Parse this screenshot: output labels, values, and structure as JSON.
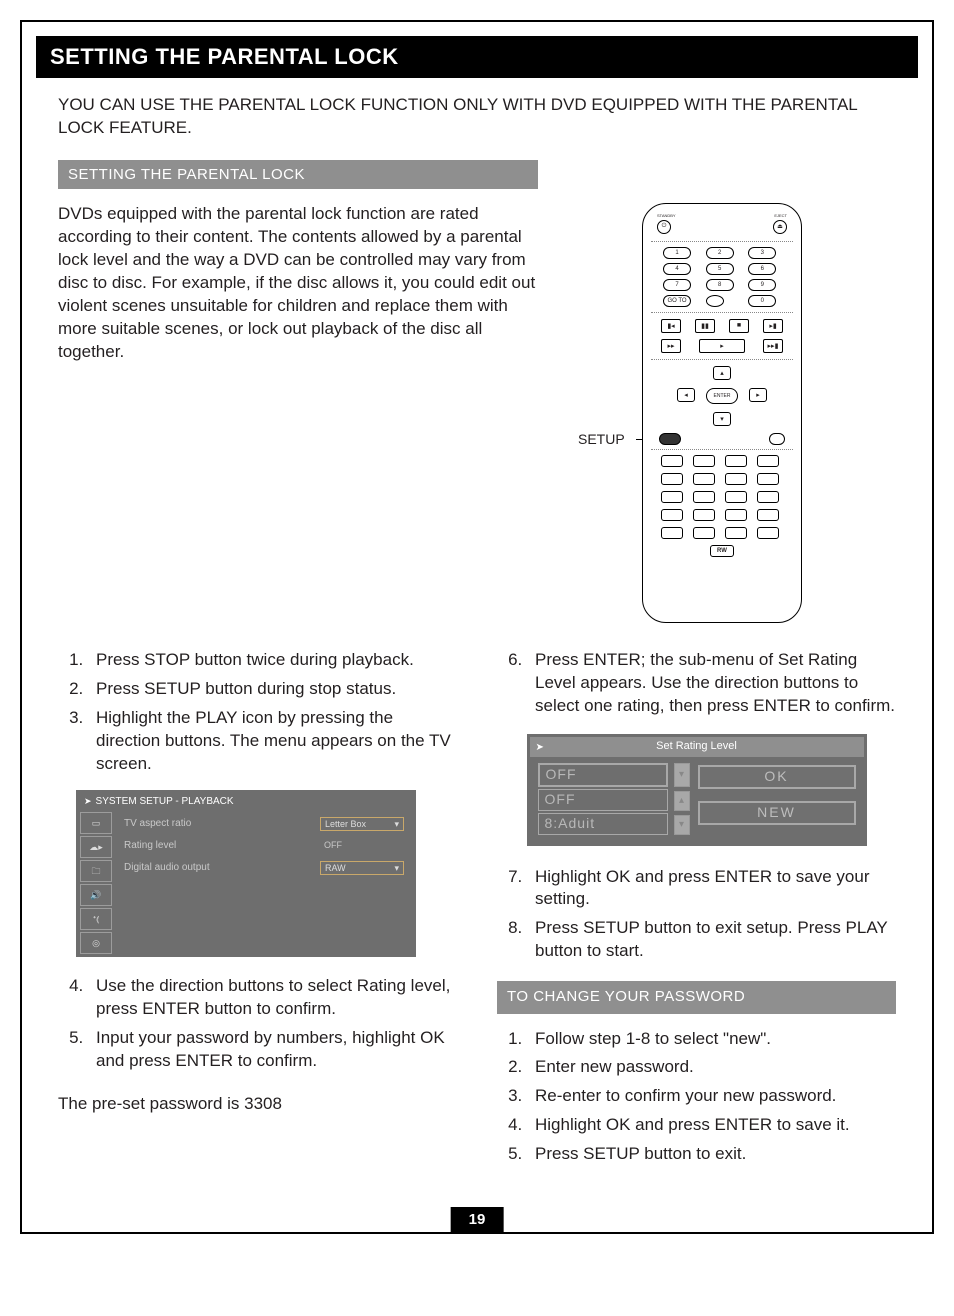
{
  "title": "SETTING THE PARENTAL LOCK",
  "intro": "YOU CAN USE THE PARENTAL LOCK FUNCTION ONLY WITH DVD EQUIPPED WITH THE PARENTAL LOCK FEATURE.",
  "sub1": "SETTING THE PARENTAL  LOCK",
  "desc": "DVDs equipped with the parental lock function are rated according to their content. The contents allowed by a parental lock level and the way a DVD can be controlled may vary from disc to disc. For example, if the disc allows it, you could edit out violent scenes unsuitable for children and replace them with more suitable scenes, or lock out playback of the disc all together.",
  "setup_label": "SETUP",
  "remote": {
    "standby": "STANDBY",
    "eject": "EJECT",
    "nums": [
      "1",
      "2",
      "3",
      "4",
      "5",
      "6",
      "7",
      "8",
      "9"
    ],
    "goto": "GO TO",
    "zero": "0",
    "enter": "ENTER",
    "rw": "RW"
  },
  "stepsL1": [
    "Press STOP button twice during playback.",
    "Press SETUP button during stop status.",
    "Highlight the PLAY icon by pressing the direction buttons. The menu appears on the TV screen."
  ],
  "osd": {
    "title": "SYSTEM SETUP  -  PLAYBACK",
    "rows": [
      {
        "l": "TV aspect ratio",
        "r": "Letter Box",
        "box": true
      },
      {
        "l": "Rating level",
        "r": "OFF",
        "box": false
      },
      {
        "l": "Digital audio output",
        "r": "RAW",
        "box": true
      }
    ]
  },
  "stepsL2": [
    "Use the direction buttons to select Rating level, press ENTER button to confirm.",
    "Input your password by numbers, highlight OK and press ENTER to confirm."
  ],
  "preset_note": "The pre-set password is 3308",
  "stepsR1": [
    "Press ENTER; the sub-menu of Set Rating Level appears. Use the direction buttons to select one rating, then press ENTER to confirm."
  ],
  "rating": {
    "title": "Set Rating Level",
    "left": [
      "OFF",
      "OFF",
      "8:Aduit"
    ],
    "right": [
      "OK",
      "NEW"
    ]
  },
  "stepsR2": [
    "Highlight OK and press ENTER to save your setting.",
    "Press SETUP button to exit setup. Press PLAY button to start."
  ],
  "sub2": "TO CHANGE YOUR PASSWORD",
  "stepsR3": [
    "Follow step 1-8 to select \"new\".",
    "Enter new password.",
    "Re-enter to confirm your new password.",
    "Highlight OK and press ENTER to save it.",
    "Press SETUP button to exit."
  ],
  "page_num": "19"
}
